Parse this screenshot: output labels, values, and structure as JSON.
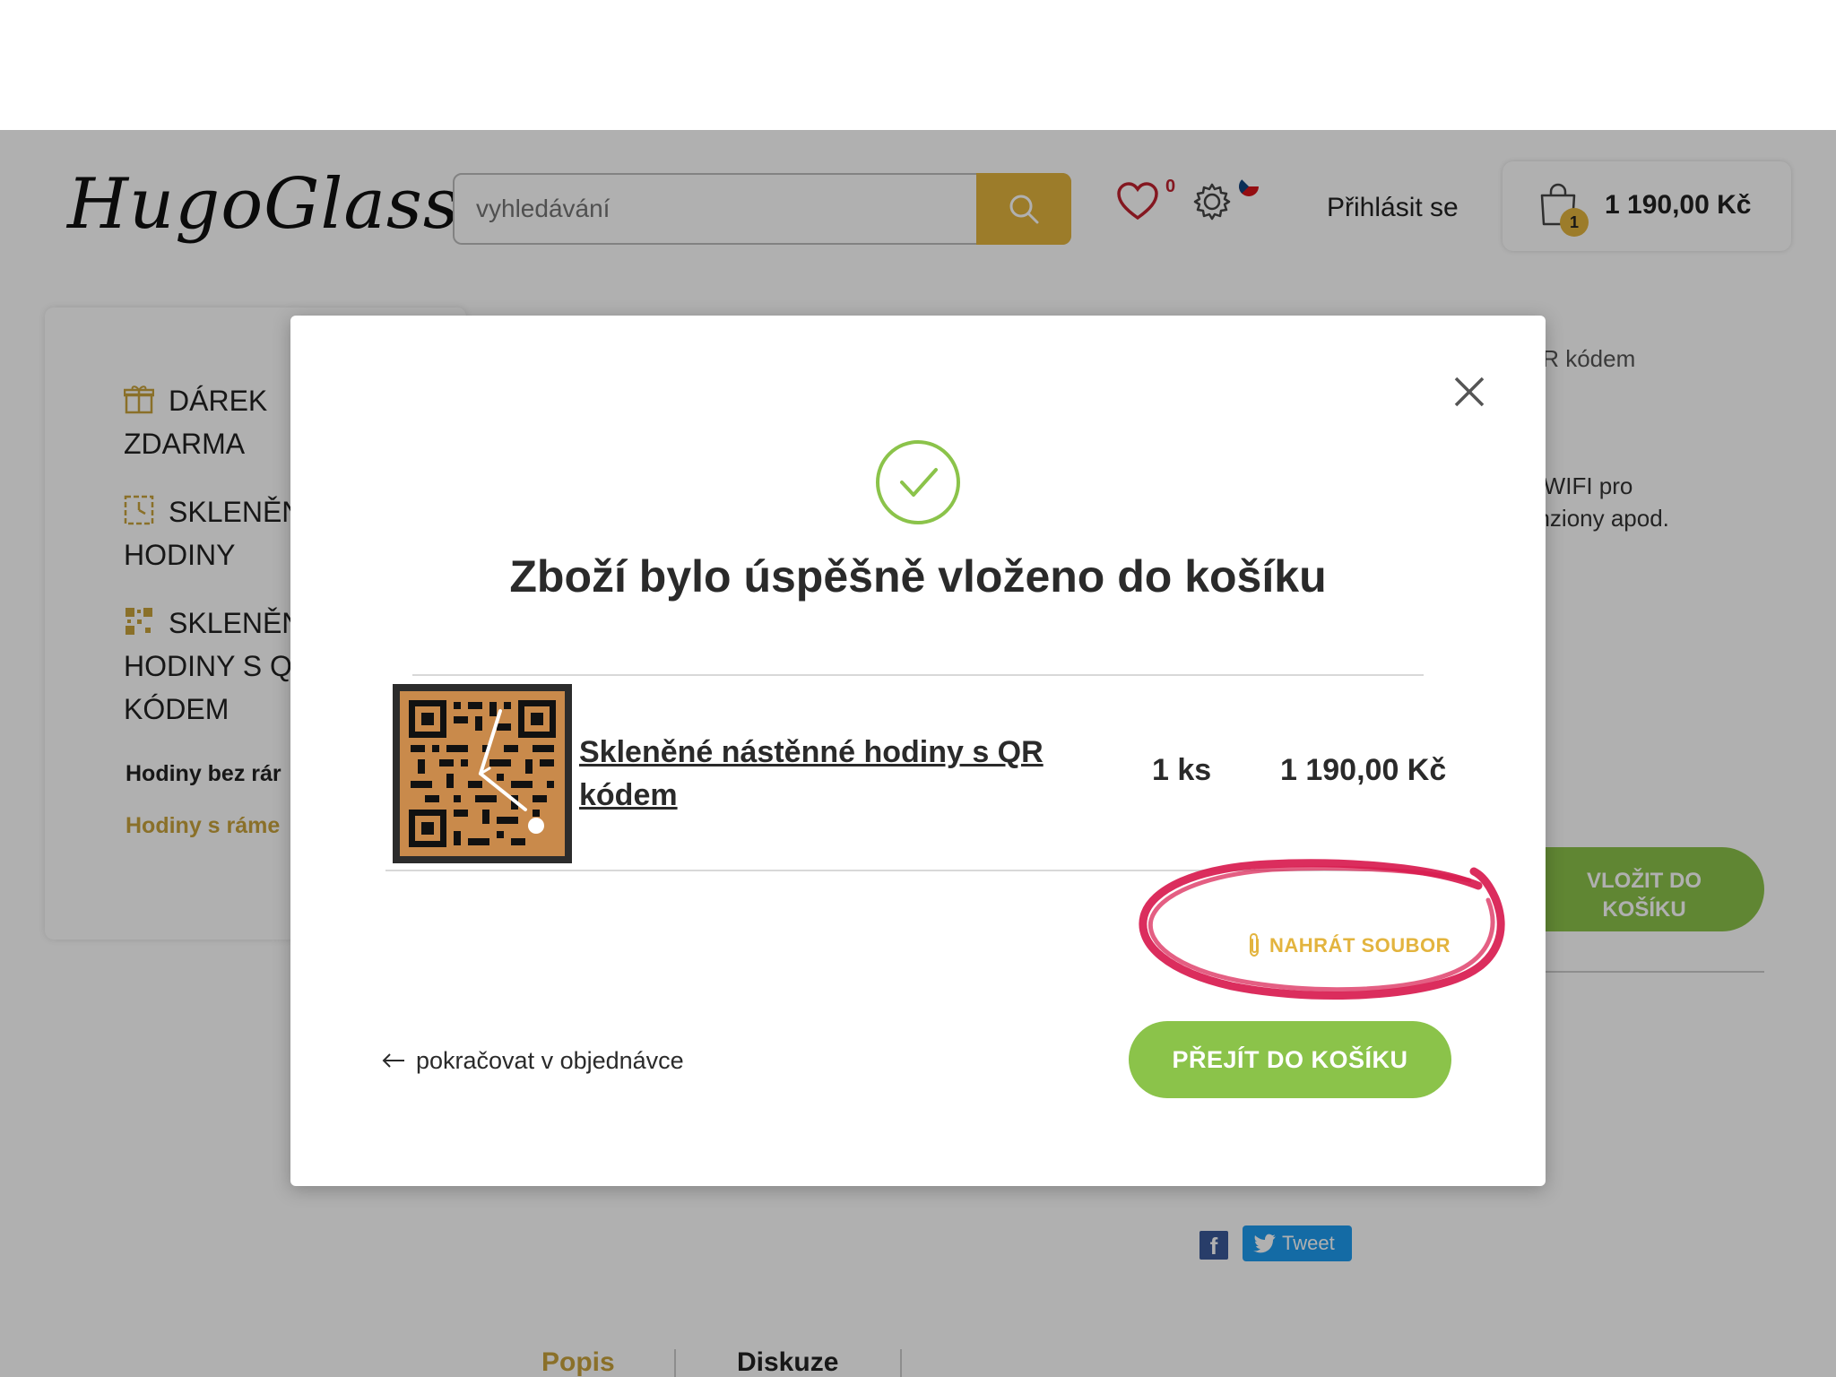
{
  "header": {
    "logo": "HugoGlass",
    "search_placeholder": "vyhledávání",
    "wishlist_count": "0",
    "login_label": "Přihlásit se",
    "cart_count": "1",
    "cart_total": "1 190,00 Kč"
  },
  "sidebar": {
    "items": [
      {
        "icon": "gift-icon",
        "label_line1": "DÁREK",
        "label_line2": "ZDARMA"
      },
      {
        "icon": "clock-icon",
        "label_line1": "SKLENĚN",
        "label_line2": "HODINY"
      },
      {
        "icon": "qr-icon",
        "label_line1": "SKLENĚN",
        "label_line2": "HODINY S Q",
        "label_line3": "KÓDEM"
      }
    ],
    "sub_items": [
      "Hodiny bez rár",
      "Hodiny s ráme"
    ]
  },
  "background": {
    "breadcrumb_fragment": "QR kódem",
    "desc_line1": "a WIFI pro",
    "desc_line2": "enziony apod.",
    "add_to_cart_line1": "VLOŽIT DO",
    "add_to_cart_line2": "KOŠÍKU",
    "facebook_label": "f",
    "tweet_label": "Tweet",
    "tabs": [
      "Popis",
      "Diskuze"
    ]
  },
  "modal": {
    "title": "Zboží bylo úspěšně vloženo do košíku",
    "product_name": "Skleněné nástěnné hodiny s QR kódem",
    "quantity": "1 ks",
    "price": "1 190,00 Kč",
    "upload_label": "NAHRÁT SOUBOR",
    "continue_label": "pokračovat v objednávce",
    "go_to_cart_label": "PŘEJÍT DO KOŠÍKU"
  },
  "colors": {
    "accent_gold": "#e3b43e",
    "accent_green": "#8bc34a",
    "marker_red": "#d81b4f",
    "heart_red": "#c0222f"
  }
}
